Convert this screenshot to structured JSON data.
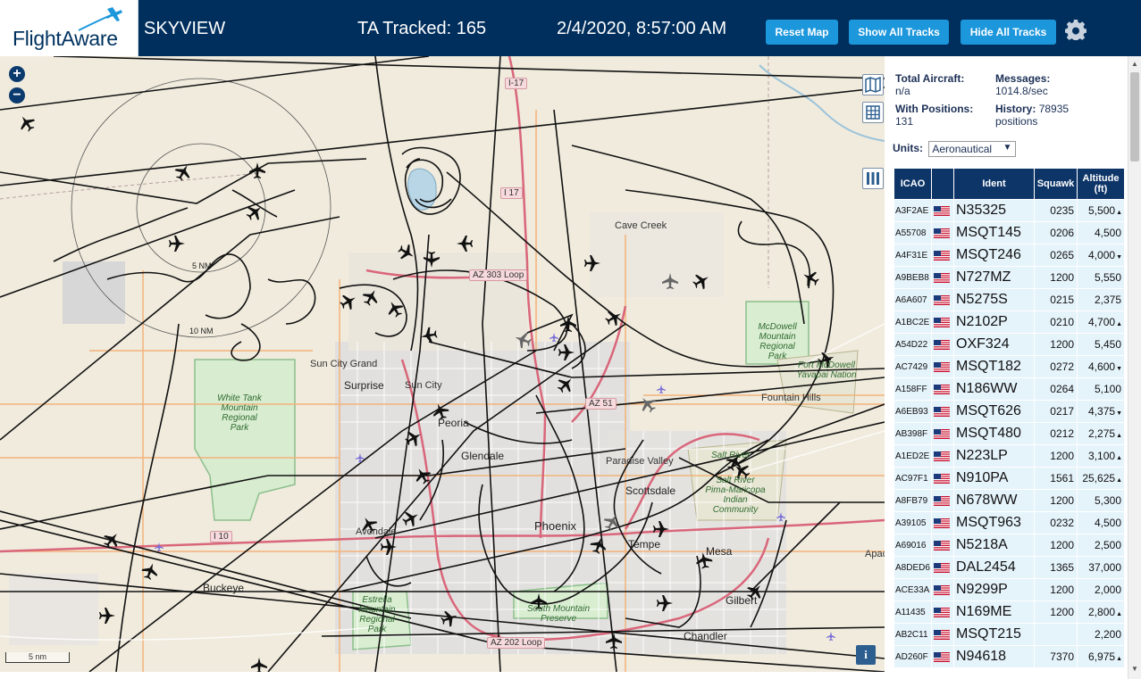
{
  "header": {
    "logo": "FlightAware",
    "title": "SKYVIEW",
    "tracked": "TA Tracked: 165",
    "datetime": "2/4/2020, 8:57:00 AM",
    "buttons": {
      "reset": "Reset Map",
      "show": "Show All Tracks",
      "hide": "Hide All Tracks"
    }
  },
  "map": {
    "zoom_in": "+",
    "zoom_out": "−",
    "info": "i",
    "scale": "5 nm",
    "rings": [
      "5 NM",
      "10 NM"
    ],
    "cities": [
      "Surprise",
      "Sun City",
      "Sun City Grand",
      "Peoria",
      "Glendale",
      "Phoenix",
      "Scottsdale",
      "Paradise Valley",
      "Tempe",
      "Mesa",
      "Gilbert",
      "Chandler",
      "Buckeye",
      "Cave Creek",
      "Fountain Hills",
      "Avondale",
      "Salt River",
      "Apac"
    ],
    "parks": [
      "White Tank Mountain Regional Park",
      "McDowell Mountain Regional Park",
      "Estrella Mountain Regional Park",
      "South Mountain Preserve",
      "Salt River Pima-Maricopa Indian Community",
      "Fort McDowell Yavapai Nation"
    ],
    "highways": [
      "I-17",
      "I 17",
      "AZ 303 Loop",
      "AZ 51",
      "I 10",
      "AZ 202 Loop"
    ]
  },
  "stats": {
    "total_label": "Total Aircraft:",
    "total_value": "n/a",
    "positions_label": "With Positions:",
    "positions_value": "131",
    "messages_label": "Messages:",
    "messages_value": "1014.8/sec",
    "history_label": "History:",
    "history_value": "78935",
    "history_unit": "positions"
  },
  "units": {
    "label": "Units:",
    "selected": "Aeronautical"
  },
  "table": {
    "headers": {
      "icao": "ICAO",
      "ident": "Ident",
      "squawk": "Squawk",
      "altitude": "Altitude (ft)"
    },
    "rows": [
      {
        "icao": "A3F2AE",
        "ident": "N35325",
        "squawk": "0235",
        "alt": "5,500",
        "trend": "▲"
      },
      {
        "icao": "A55708",
        "ident": "MSQT145",
        "squawk": "0206",
        "alt": "4,500",
        "trend": ""
      },
      {
        "icao": "A4F31E",
        "ident": "MSQT246",
        "squawk": "0265",
        "alt": "4,000",
        "trend": "▼"
      },
      {
        "icao": "A9BEB8",
        "ident": "N727MZ",
        "squawk": "1200",
        "alt": "5,550",
        "trend": ""
      },
      {
        "icao": "A6A607",
        "ident": "N5275S",
        "squawk": "0215",
        "alt": "2,375",
        "trend": ""
      },
      {
        "icao": "A1BC2E",
        "ident": "N2102P",
        "squawk": "0210",
        "alt": "4,700",
        "trend": "▲"
      },
      {
        "icao": "A54D22",
        "ident": "OXF324",
        "squawk": "1200",
        "alt": "5,450",
        "trend": ""
      },
      {
        "icao": "AC7429",
        "ident": "MSQT182",
        "squawk": "0272",
        "alt": "4,600",
        "trend": "▼"
      },
      {
        "icao": "A158FF",
        "ident": "N186WW",
        "squawk": "0264",
        "alt": "5,100",
        "trend": ""
      },
      {
        "icao": "A6EB93",
        "ident": "MSQT626",
        "squawk": "0217",
        "alt": "4,375",
        "trend": "▼"
      },
      {
        "icao": "AB398F",
        "ident": "MSQT480",
        "squawk": "0212",
        "alt": "2,275",
        "trend": "▲"
      },
      {
        "icao": "A1ED2E",
        "ident": "N223LP",
        "squawk": "1200",
        "alt": "3,100",
        "trend": "▲"
      },
      {
        "icao": "AC97F1",
        "ident": "N910PA",
        "squawk": "1561",
        "alt": "25,625",
        "trend": "▲"
      },
      {
        "icao": "A8FB79",
        "ident": "N678WW",
        "squawk": "1200",
        "alt": "5,300",
        "trend": ""
      },
      {
        "icao": "A39105",
        "ident": "MSQT963",
        "squawk": "0232",
        "alt": "4,500",
        "trend": ""
      },
      {
        "icao": "A69016",
        "ident": "N5218A",
        "squawk": "1200",
        "alt": "2,500",
        "trend": ""
      },
      {
        "icao": "A8DED6",
        "ident": "DAL2454",
        "squawk": "1365",
        "alt": "37,000",
        "trend": ""
      },
      {
        "icao": "ACE33A",
        "ident": "N9299P",
        "squawk": "1200",
        "alt": "2,000",
        "trend": ""
      },
      {
        "icao": "A11435",
        "ident": "N169ME",
        "squawk": "1200",
        "alt": "2,800",
        "trend": "▲"
      },
      {
        "icao": "AB2C11",
        "ident": "MSQT215",
        "squawk": "",
        "alt": "2,200",
        "trend": ""
      },
      {
        "icao": "AD260F",
        "ident": "N94618",
        "squawk": "7370",
        "alt": "6,975",
        "trend": "▲"
      }
    ]
  },
  "colors": {
    "header_bg": "#002f5d",
    "button": "#1c97dc",
    "table_header": "#0e3568",
    "row_bg": "#e5f3fb"
  }
}
